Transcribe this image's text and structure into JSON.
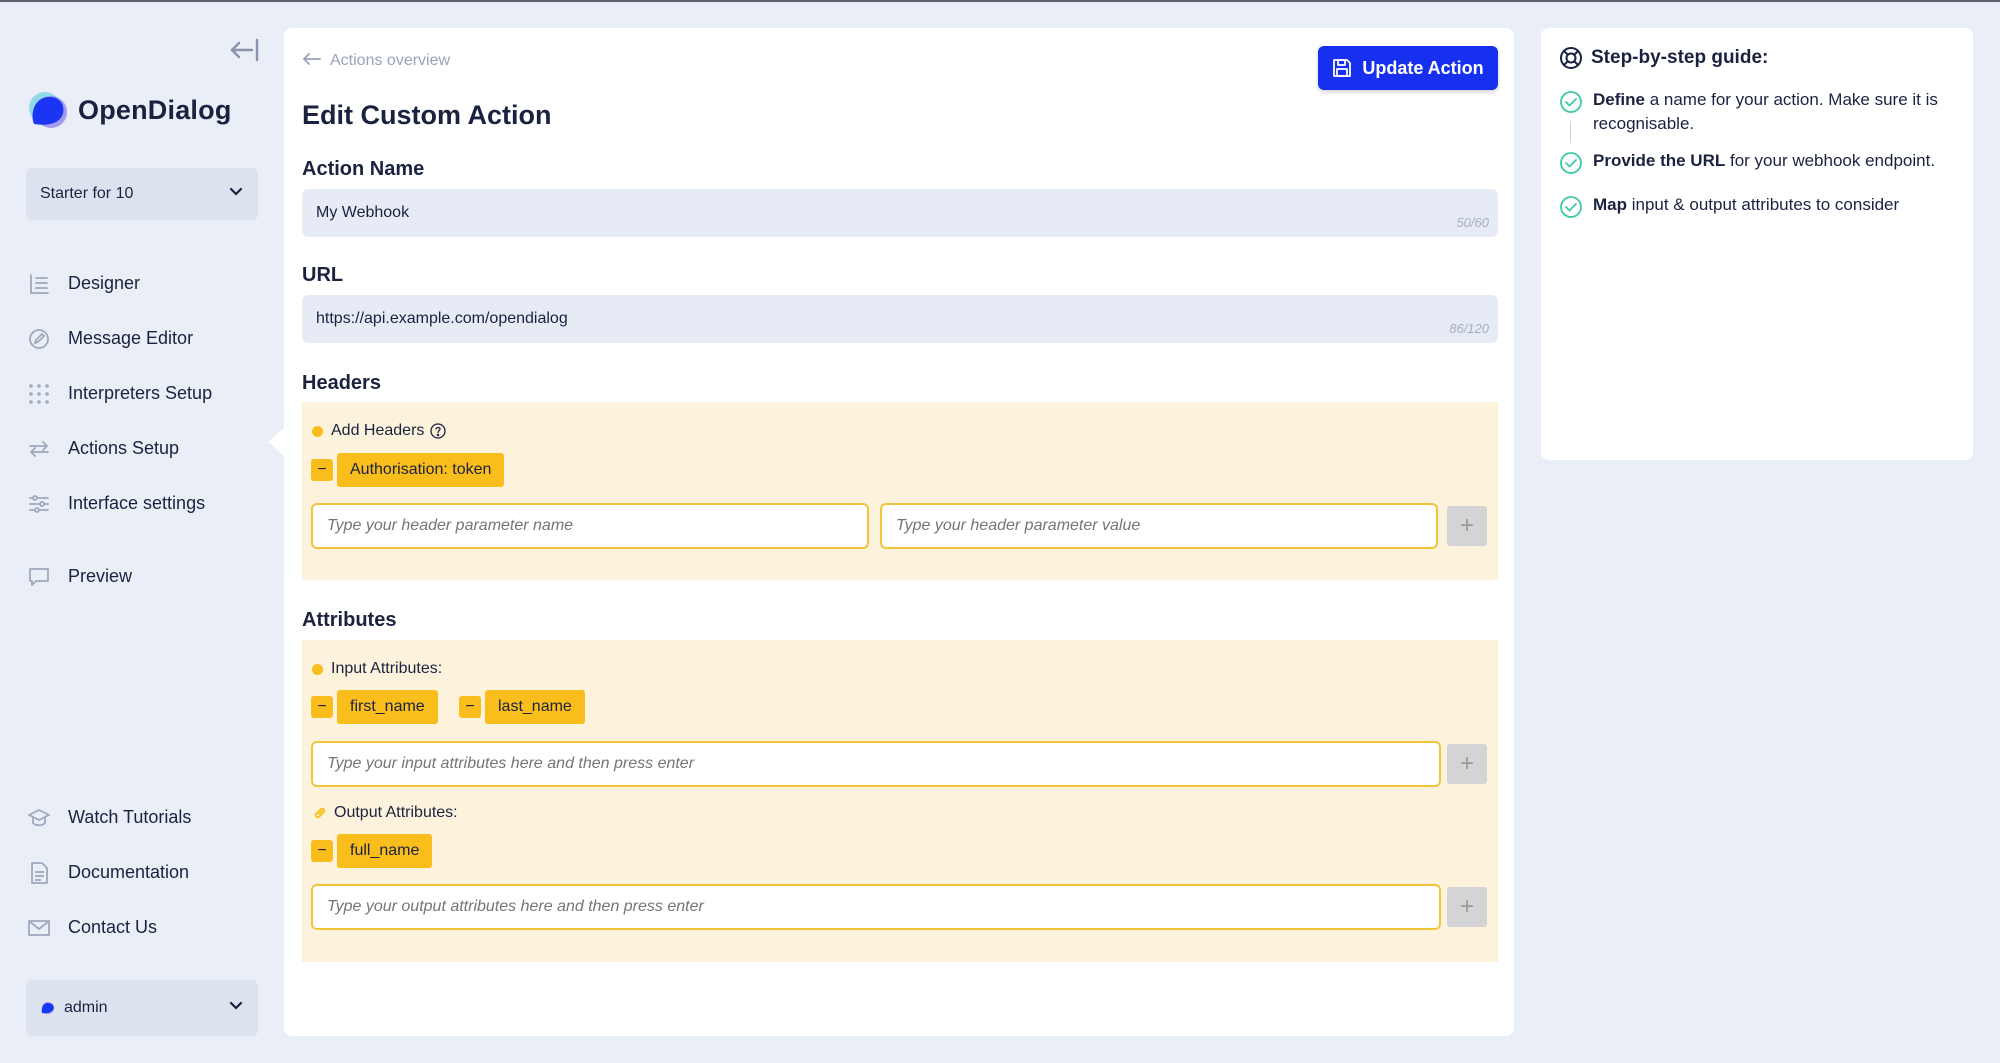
{
  "app": {
    "name": "OpenDialog"
  },
  "workspace": {
    "selected": "Starter for 10"
  },
  "sidebar": {
    "items": [
      {
        "label": "Designer",
        "icon": "designer-icon"
      },
      {
        "label": "Message Editor",
        "icon": "message-editor-icon"
      },
      {
        "label": "Interpreters Setup",
        "icon": "interpreters-icon"
      },
      {
        "label": "Actions Setup",
        "icon": "actions-icon",
        "active": true
      },
      {
        "label": "Interface settings",
        "icon": "sliders-icon"
      },
      {
        "label": "Preview",
        "icon": "preview-icon"
      }
    ],
    "bottom_items": [
      {
        "label": "Watch Tutorials",
        "icon": "tutorials-icon"
      },
      {
        "label": "Documentation",
        "icon": "documentation-icon"
      },
      {
        "label": "Contact Us",
        "icon": "mail-icon"
      }
    ],
    "user": {
      "name": "admin"
    }
  },
  "main": {
    "back_link": "Actions overview",
    "update_button": "Update Action",
    "title": "Edit Custom Action",
    "action_name": {
      "label": "Action Name",
      "value": "My Webhook",
      "counter": "50/60"
    },
    "url": {
      "label": "URL",
      "value": "https://api.example.com/opendialog",
      "counter": "86/120"
    },
    "headers": {
      "label": "Headers",
      "add_label": "Add Headers",
      "chips": [
        "Authorisation: token"
      ],
      "name_placeholder": "Type your header parameter name",
      "value_placeholder": "Type your header parameter value"
    },
    "attributes": {
      "label": "Attributes",
      "input_label": "Input Attributes:",
      "input_chips": [
        "first_name",
        "last_name"
      ],
      "input_placeholder": "Type your input attributes here and then press enter",
      "output_label": "Output Attributes:",
      "output_chips": [
        "full_name"
      ],
      "output_placeholder": "Type your output attributes here and then press enter"
    }
  },
  "guide": {
    "title": "Step-by-step guide:",
    "steps": [
      {
        "bold": "Define",
        "text": " a name for your action. Make sure it is recognisable."
      },
      {
        "bold": "Provide the URL",
        "text": " for your webhook endpoint."
      },
      {
        "bold": "Map",
        "text": " input & output attributes to consider"
      }
    ]
  },
  "colors": {
    "primary": "#1730f0",
    "chip": "#f9bd1c",
    "section_bg": "#fdf3dc",
    "check": "#3ec9a7"
  }
}
